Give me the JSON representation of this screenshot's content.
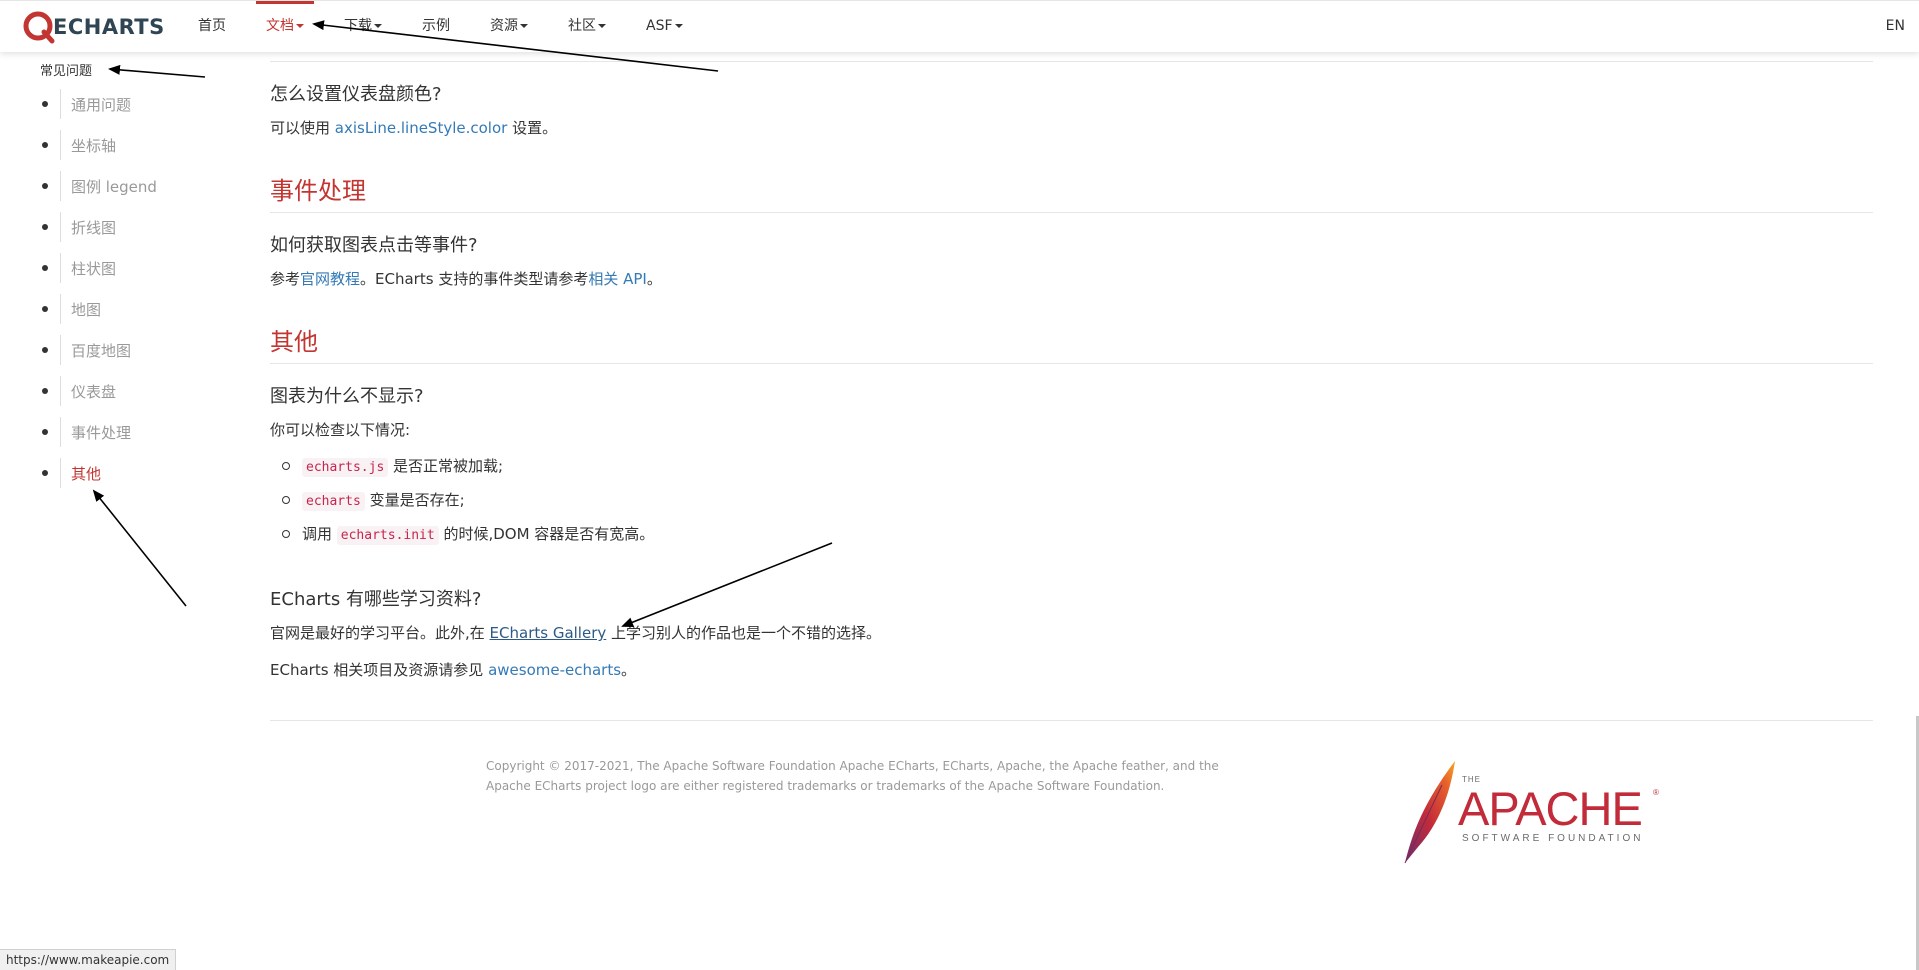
{
  "nav": {
    "logo_text": "ECHARTS",
    "items": [
      {
        "label": "首页",
        "dropdown": false,
        "active": false
      },
      {
        "label": "文档",
        "dropdown": true,
        "active": true
      },
      {
        "label": "下载",
        "dropdown": true,
        "active": false
      },
      {
        "label": "示例",
        "dropdown": false,
        "active": false
      },
      {
        "label": "资源",
        "dropdown": true,
        "active": false
      },
      {
        "label": "社区",
        "dropdown": true,
        "active": false
      },
      {
        "label": "ASF",
        "dropdown": true,
        "active": false
      }
    ],
    "lang": "EN"
  },
  "sidebar": {
    "heading": "常见问题",
    "items": [
      {
        "label": "通用问题"
      },
      {
        "label": "坐标轴"
      },
      {
        "label": "图例 legend"
      },
      {
        "label": "折线图"
      },
      {
        "label": "柱状图"
      },
      {
        "label": "地图"
      },
      {
        "label": "百度地图"
      },
      {
        "label": "仪表盘"
      },
      {
        "label": "事件处理"
      },
      {
        "label": "其他",
        "active": true
      }
    ]
  },
  "content": {
    "gauge_q": "怎么设置仪表盘颜色?",
    "gauge_a_pre": "可以使用 ",
    "gauge_a_link": "axisLine.lineStyle.color",
    "gauge_a_post": " 设置。",
    "events_title": "事件处理",
    "events_q": "如何获取图表点击等事件?",
    "events_a_pre": "参考",
    "events_a_link1": "官网教程",
    "events_a_mid": "。ECharts 支持的事件类型请参考",
    "events_a_link2": "相关 API",
    "events_a_post": "。",
    "other_title": "其他",
    "other_q1": "图表为什么不显示?",
    "other_q1_intro": "你可以检查以下情况:",
    "check1_code": "echarts.js",
    "check1_text": " 是否正常被加载;",
    "check2_code": "echarts",
    "check2_text": " 变量是否存在;",
    "check3_pre": "调用 ",
    "check3_code": "echarts.init",
    "check3_text": " 的时候,DOM 容器是否有宽高。",
    "other_q2": "ECharts 有哪些学习资料?",
    "q2_a1_pre": "官网是最好的学习平台。此外,在 ",
    "q2_a1_link": "ECharts Gallery",
    "q2_a1_post": " 上学习别人的作品也是一个不错的选择。",
    "q2_a2_pre": "ECharts 相关项目及资源请参见 ",
    "q2_a2_link": "awesome-echarts",
    "q2_a2_post": "。"
  },
  "footer": {
    "copyright": "Copyright © 2017-2021, The Apache Software Foundation Apache ECharts, ECharts, Apache, the Apache feather, and the Apache ECharts project logo are either registered trademarks or trademarks of the Apache Software Foundation.",
    "apache_the": "THE",
    "apache_name": "APACHE",
    "apache_sub": "SOFTWARE FOUNDATION",
    "apache_reg": "®"
  },
  "statusbar": {
    "url": "https://www.makeapie.com"
  },
  "colors": {
    "accent": "#c23531",
    "link": "#337ab7",
    "muted": "#999999",
    "code": "#c7254e"
  }
}
